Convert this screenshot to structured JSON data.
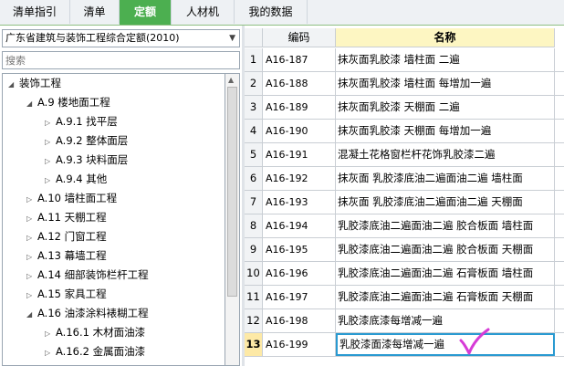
{
  "tabs": [
    {
      "label": "清单指引",
      "active": false
    },
    {
      "label": "清单",
      "active": false
    },
    {
      "label": "定额",
      "active": true
    },
    {
      "label": "人材机",
      "active": false
    },
    {
      "label": "我的数据",
      "active": false
    }
  ],
  "left": {
    "quota_library": "广东省建筑与装饰工程综合定额(2010)",
    "search_placeholder": "搜索",
    "tree": [
      {
        "label": "装饰工程",
        "expanded": true,
        "level": 0
      },
      {
        "label": "A.9 楼地面工程",
        "expanded": true,
        "level": 1
      },
      {
        "label": "A.9.1 找平层",
        "expanded": false,
        "level": 2
      },
      {
        "label": "A.9.2 整体面层",
        "expanded": false,
        "level": 2
      },
      {
        "label": "A.9.3 块料面层",
        "expanded": false,
        "level": 2
      },
      {
        "label": "A.9.4 其他",
        "expanded": false,
        "level": 2
      },
      {
        "label": "A.10 墙柱面工程",
        "expanded": false,
        "level": 1
      },
      {
        "label": "A.11 天棚工程",
        "expanded": false,
        "level": 1
      },
      {
        "label": "A.12 门窗工程",
        "expanded": false,
        "level": 1
      },
      {
        "label": "A.13 幕墙工程",
        "expanded": false,
        "level": 1
      },
      {
        "label": "A.14 细部装饰栏杆工程",
        "expanded": false,
        "level": 1
      },
      {
        "label": "A.15 家具工程",
        "expanded": false,
        "level": 1
      },
      {
        "label": "A.16 油漆涂料裱糊工程",
        "expanded": true,
        "level": 1
      },
      {
        "label": "A.16.1 木材面油漆",
        "expanded": false,
        "level": 2
      },
      {
        "label": "A.16.2 金属面油漆",
        "expanded": false,
        "level": 2
      }
    ]
  },
  "grid": {
    "headers": {
      "code": "编码",
      "name": "名称"
    },
    "rows": [
      {
        "idx": "1",
        "code": "A16-187",
        "name": "抹灰面乳胶漆 墙柱面 二遍"
      },
      {
        "idx": "2",
        "code": "A16-188",
        "name": "抹灰面乳胶漆 墙柱面 每增加一遍"
      },
      {
        "idx": "3",
        "code": "A16-189",
        "name": "抹灰面乳胶漆 天棚面 二遍"
      },
      {
        "idx": "4",
        "code": "A16-190",
        "name": "抹灰面乳胶漆 天棚面 每增加一遍"
      },
      {
        "idx": "5",
        "code": "A16-191",
        "name": "混凝土花格窗栏杆花饰乳胶漆二遍"
      },
      {
        "idx": "6",
        "code": "A16-192",
        "name": "抹灰面 乳胶漆底油二遍面油二遍 墙柱面"
      },
      {
        "idx": "7",
        "code": "A16-193",
        "name": "抹灰面 乳胶漆底油二遍面油二遍 天棚面"
      },
      {
        "idx": "8",
        "code": "A16-194",
        "name": "乳胶漆底油二遍面油二遍 胶合板面 墙柱面"
      },
      {
        "idx": "9",
        "code": "A16-195",
        "name": "乳胶漆底油二遍面油二遍 胶合板面 天棚面"
      },
      {
        "idx": "10",
        "code": "A16-196",
        "name": "乳胶漆底油二遍面油二遍 石膏板面 墙柱面"
      },
      {
        "idx": "11",
        "code": "A16-197",
        "name": "乳胶漆底油二遍面油二遍 石膏板面 天棚面"
      },
      {
        "idx": "12",
        "code": "A16-198",
        "name": "乳胶漆底漆每增减一遍"
      },
      {
        "idx": "13",
        "code": "A16-199",
        "name": "乳胶漆面漆每增减一遍",
        "selected": true
      }
    ]
  },
  "colors": {
    "accent": "#4caf50",
    "selection": "#2a9ad1",
    "checkmark": "#d63bd6"
  }
}
